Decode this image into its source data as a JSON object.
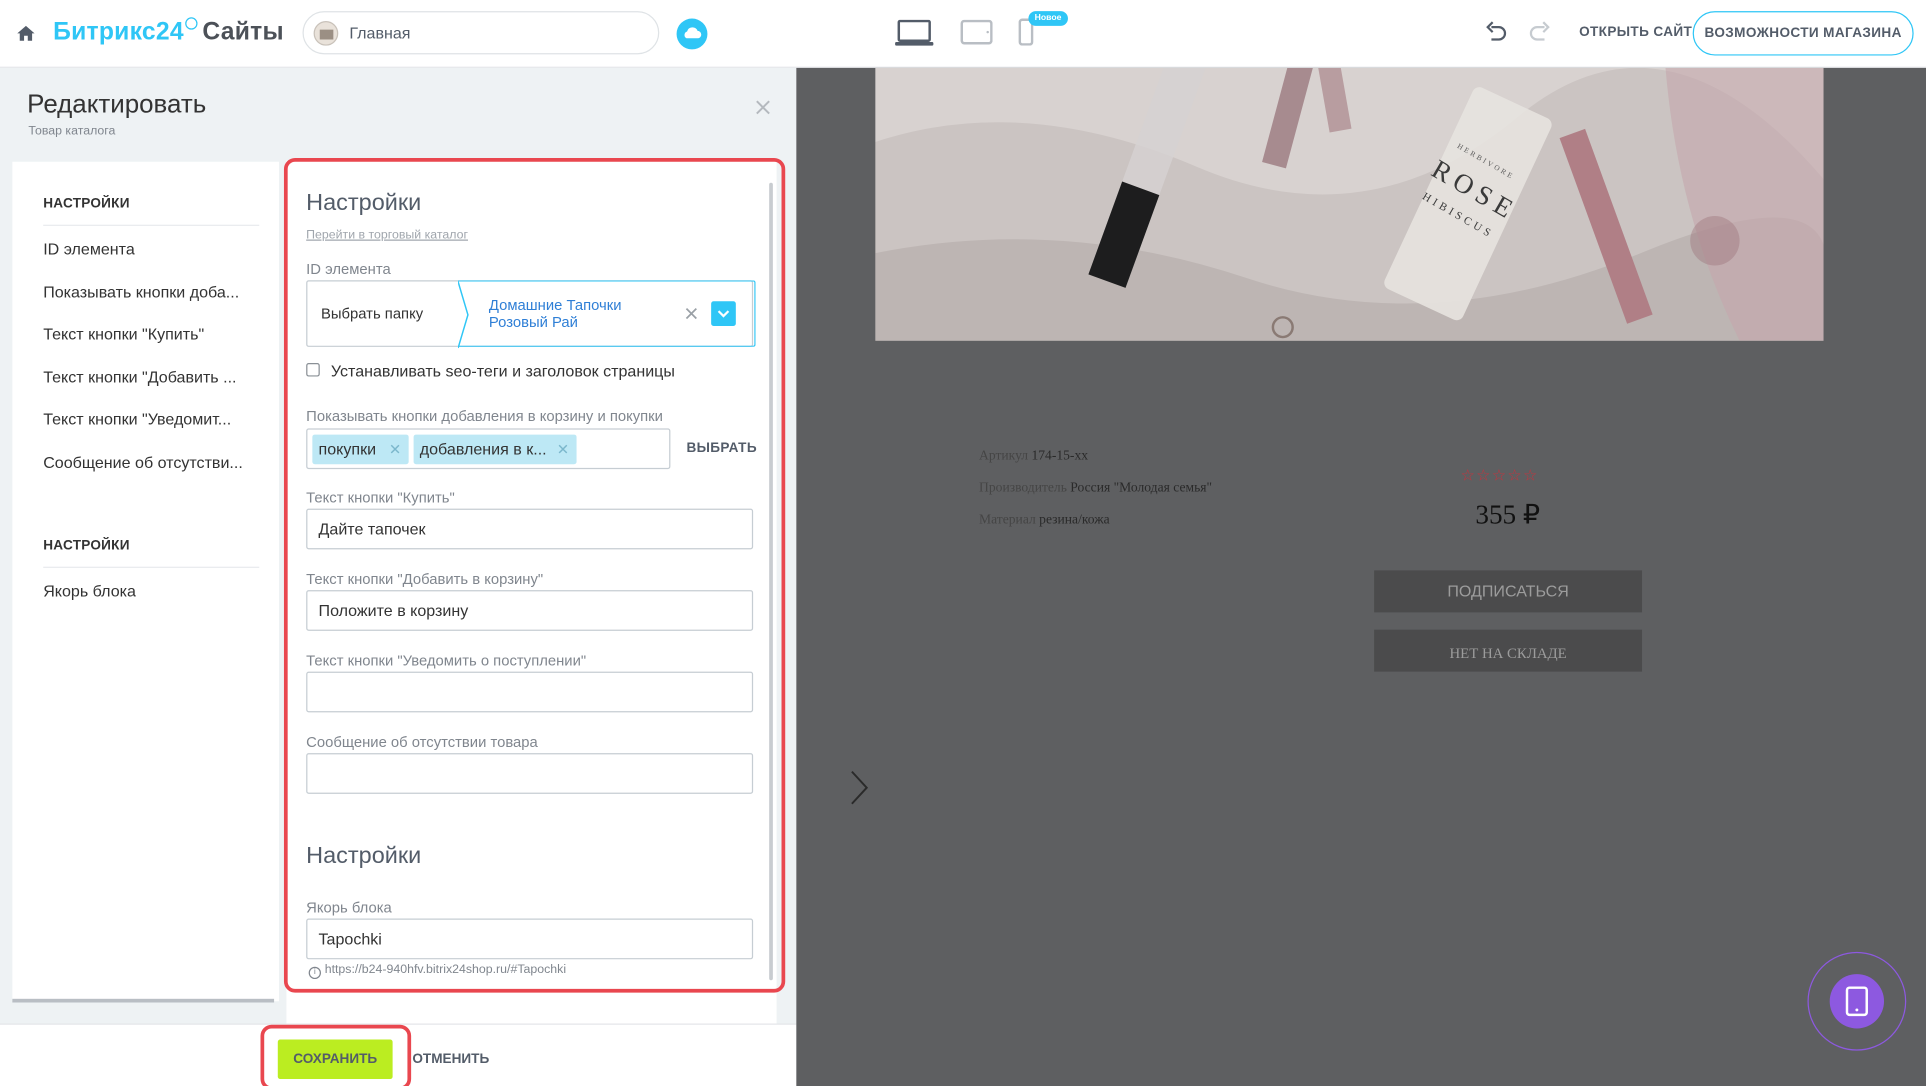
{
  "topbar": {
    "logo_brand": "Битрикс24",
    "logo_product": "Сайты",
    "page_name": "Главная",
    "new_badge": "Новое",
    "open_site": "ОТКРЫТЬ САЙТ",
    "shop_features": "ВОЗМОЖНОСТИ МАГАЗИНА",
    "accent_color": "#2fc6f6"
  },
  "editor": {
    "title": "Редактировать",
    "subtitle": "Товар каталога",
    "nav": {
      "section1": "НАСТРОЙКИ",
      "items1": [
        "ID элемента",
        "Показывать кнопки доба...",
        "Текст кнопки \"Купить\"",
        "Текст кнопки \"Добавить ...",
        "Текст кнопки \"Уведомит...",
        "Сообщение об отсутстви..."
      ],
      "section2": "НАСТРОЙКИ",
      "items2": [
        "Якорь блока"
      ]
    },
    "form": {
      "heading1": "Настройки",
      "catalog_link": "Перейти в торговый каталог",
      "id_label": "ID элемента",
      "id_folder": "Выбрать папку",
      "id_value": "Домашние Тапочки Розовый Рай",
      "seo_checkbox": "Устанавливать seo-теги и заголовок страницы",
      "seo_checked": false,
      "buttons_label": "Показывать кнопки добавления в корзину и покупки",
      "tags": [
        "покупки",
        "добавления в к..."
      ],
      "choose": "ВЫБРАТЬ",
      "buy_label": "Текст кнопки \"Купить\"",
      "buy_value": "Дайте тапочек",
      "add_label": "Текст кнопки \"Добавить в корзину\"",
      "add_value": "Положите в корзину",
      "notify_label": "Текст кнопки \"Уведомить о поступлении\"",
      "notify_value": "",
      "absent_label": "Сообщение об отсутствии товара",
      "absent_value": "",
      "heading2": "Настройки",
      "anchor_label": "Якорь блока",
      "anchor_value": "Tapochki",
      "anchor_url": "https://b24-940hfv.bitrix24shop.ru/#Tapochki"
    },
    "save": "СОХРАНИТЬ",
    "cancel": "ОТМЕНИТЬ"
  },
  "preview": {
    "sku_label": "Артикул",
    "sku_value": "174-15-xx",
    "maker_label": "Производитель",
    "maker_value": "Россия \"Молодая семья\"",
    "material_label": "Материал",
    "material_value": "резина/кожа",
    "rating": 0,
    "stars": "☆☆☆☆☆",
    "price": "355 ₽",
    "subscribe": "ПОДПИСАТЬСЯ",
    "out_of_stock": "НЕТ НА СКЛАДЕ",
    "photo_caption_1": "ROSE",
    "photo_caption_2": "HIBISCUS",
    "photo_caption_3": "HERBIVORE"
  }
}
